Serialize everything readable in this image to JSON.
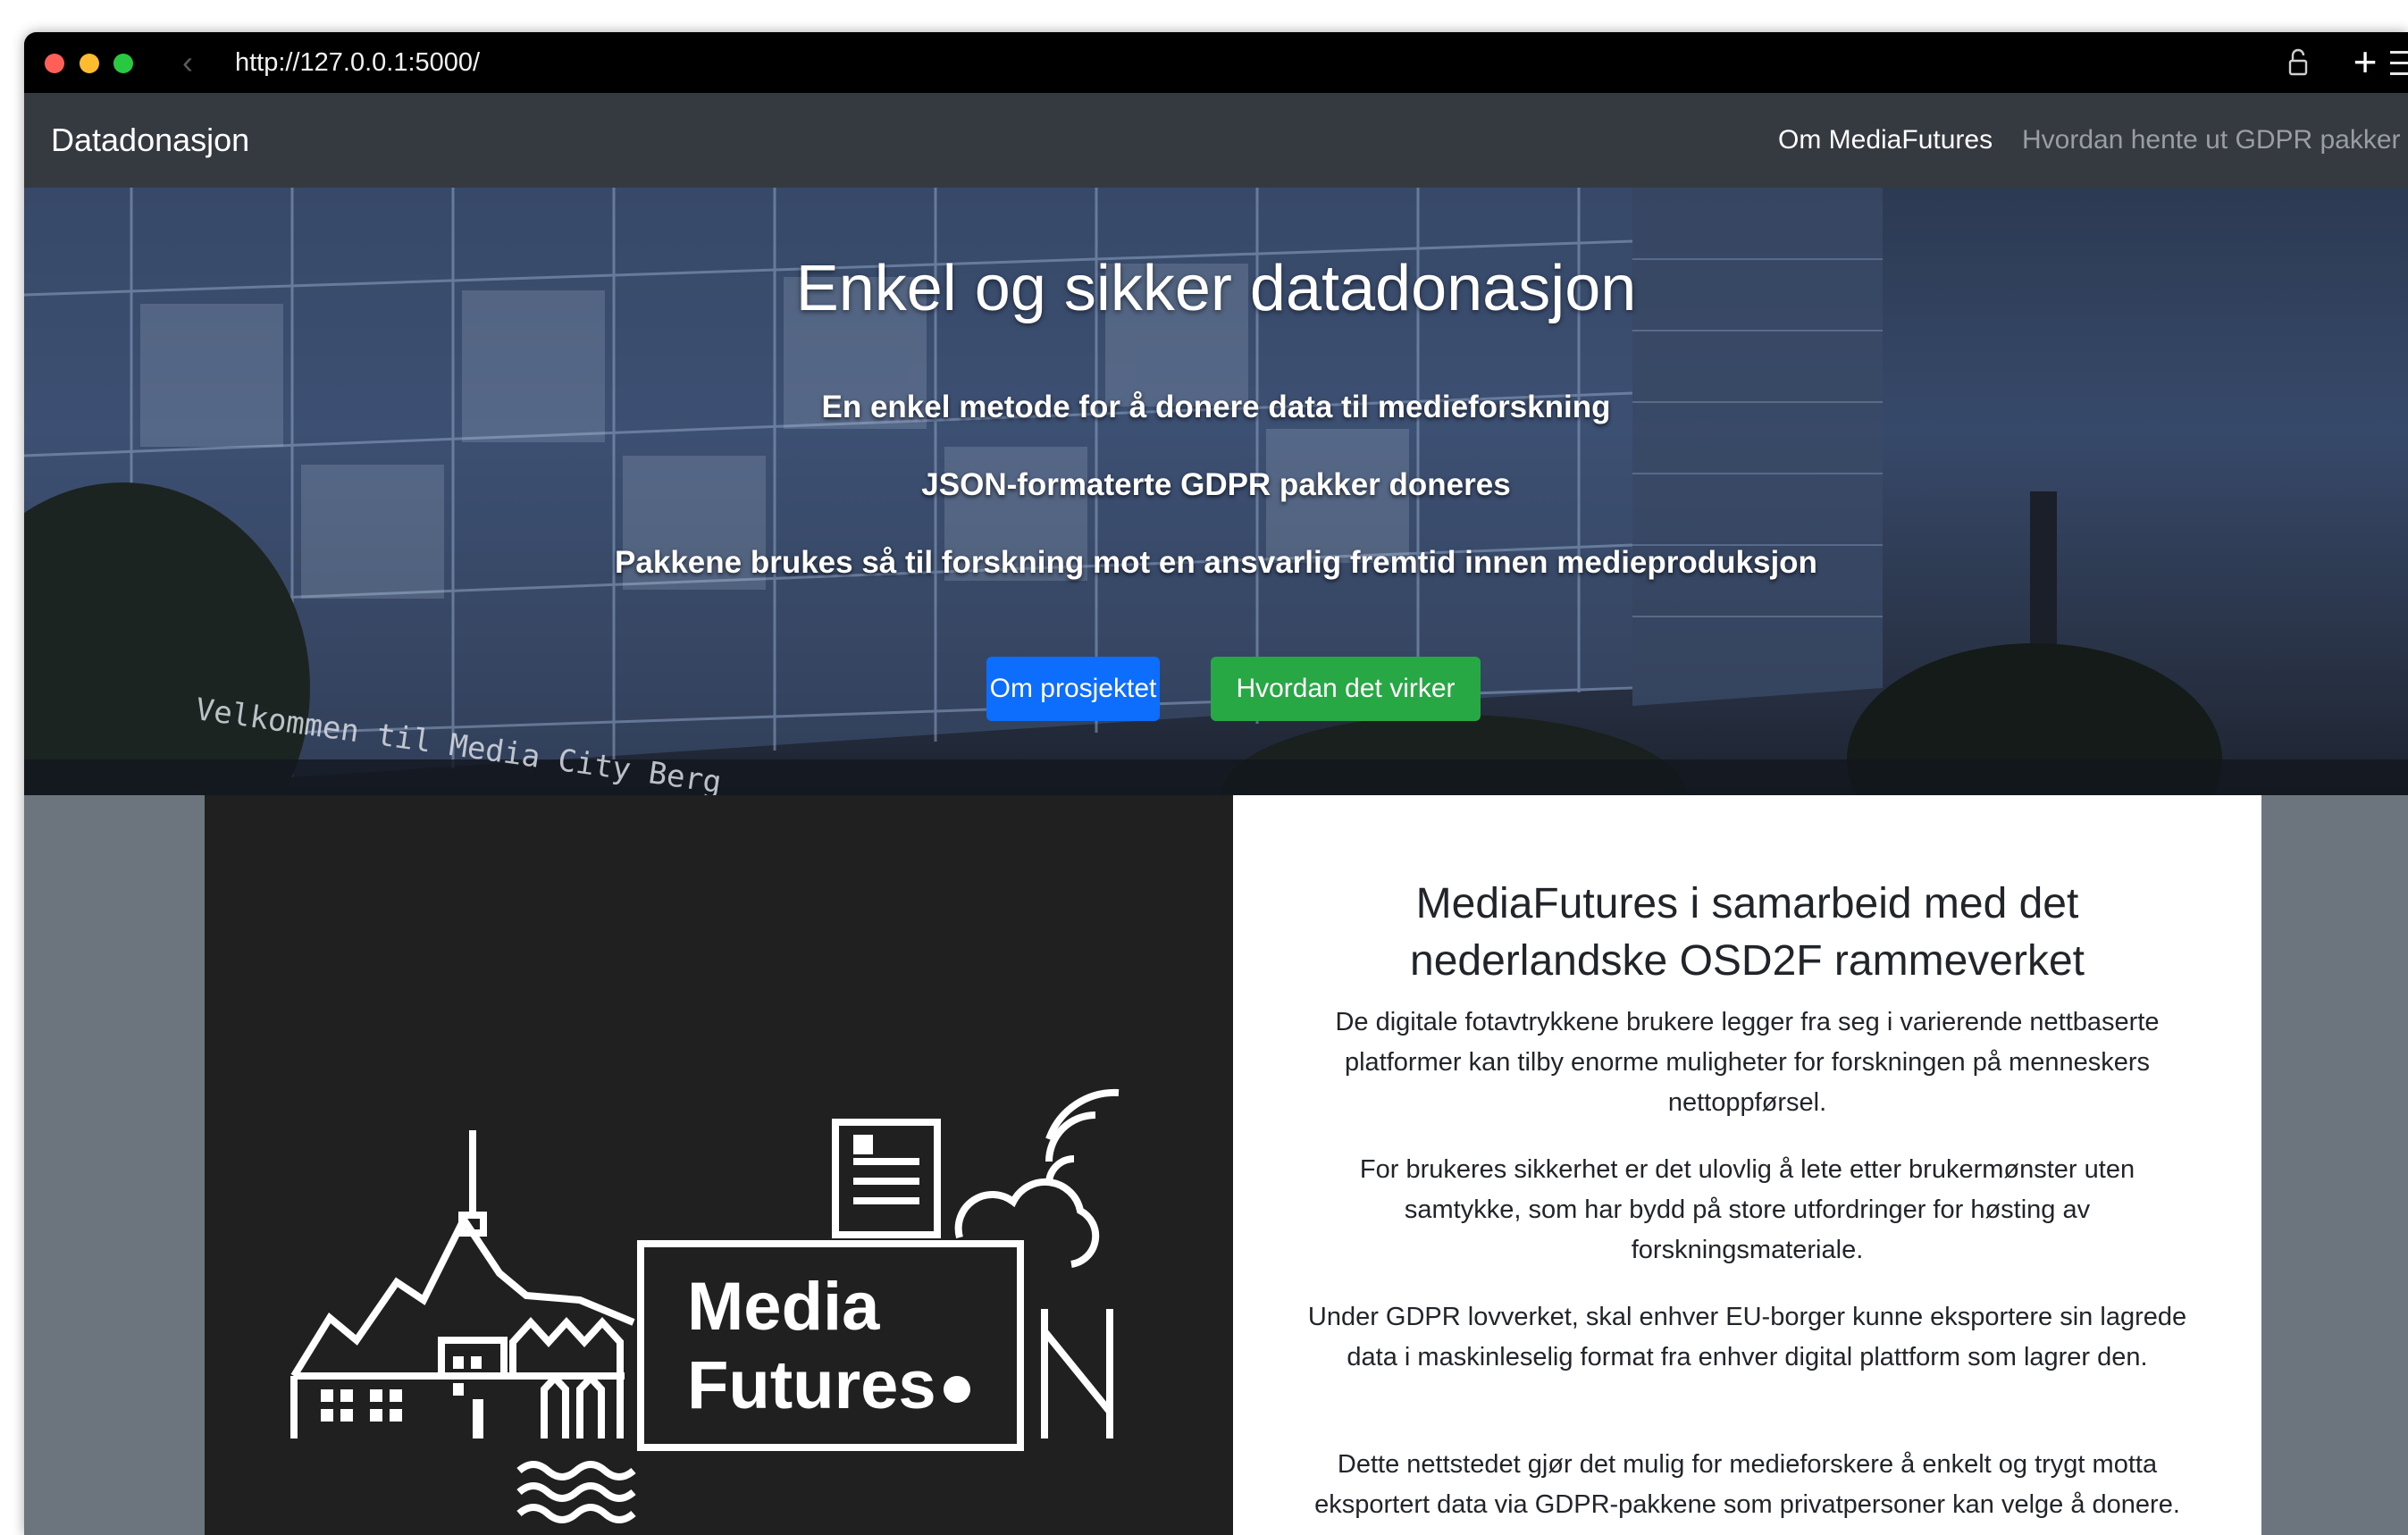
{
  "browser": {
    "url": "http://127.0.0.1:5000/",
    "back_icon": "chevron-left-icon",
    "lock_icon": "lock-icon",
    "new_tab_icon": "plus-icon",
    "menu_icon": "hamburger-menu-icon"
  },
  "navbar": {
    "brand": "Datadonasjon",
    "links": [
      {
        "label": "Om MediaFutures",
        "state": "active"
      },
      {
        "label": "Hvordan hente ut GDPR pakker",
        "state": "muted"
      }
    ]
  },
  "hero": {
    "title": "Enkel og sikker datadonasjon",
    "lines": [
      "En enkel metode for å donere data til medieforskning",
      "JSON-formaterte GDPR pakker doneres",
      "Pakkene brukes så til forskning mot en ansvarlig fremtid innen medieproduksjon"
    ],
    "buttons": {
      "primary": "Om prosjektet",
      "success": "Hvordan det virker"
    },
    "background_sign": "Velkommen til Media City Berg"
  },
  "logo": {
    "line1": "Media",
    "line2": "Futures"
  },
  "info": {
    "title": "MediaFutures i samarbeid med det nederlandske OSD2F rammeverket",
    "paragraphs": [
      "De digitale fotavtrykkene brukere legger fra seg i varierende nettbaserte platformer kan tilby enorme muligheter for forskningen på menneskers nettoppførsel.",
      "For brukeres sikkerhet er det ulovlig å lete etter brukermønster uten samtykke, som har bydd på store utfordringer for høsting av forskningsmateriale.",
      "Under GDPR lovverket, skal enhver EU-borger kunne eksportere sin lagrede data i maskinleselig format fra enhver digital plattform som lagrer den.",
      "Dette nettstedet gjør det mulig for medieforskere å enkelt og trygt motta eksportert data via GDPR-pakkene som privatpersoner kan velge å donere."
    ]
  },
  "colors": {
    "navbar": "#343a40",
    "primary": "#0d6efd",
    "success": "#28a745",
    "page_background": "#6c757d",
    "logo_panel": "#202020"
  }
}
